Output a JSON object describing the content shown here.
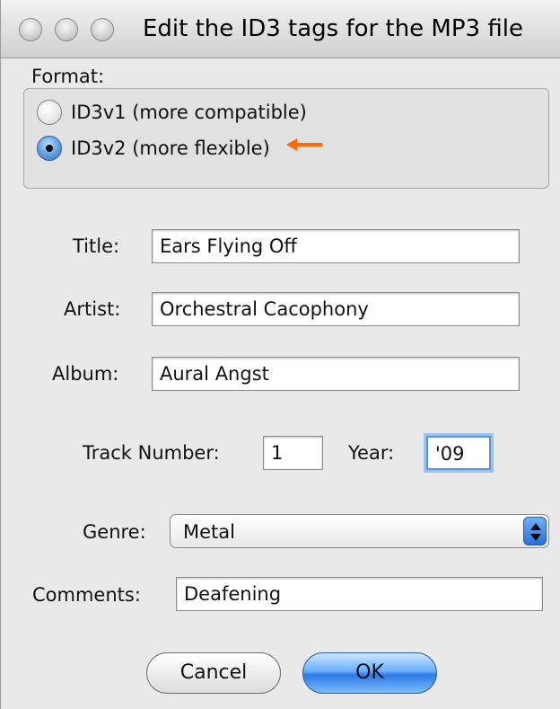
{
  "window": {
    "title": "Edit the ID3 tags for the MP3 file"
  },
  "format": {
    "label": "Format:",
    "options": [
      {
        "label": "ID3v1 (more compatible)",
        "selected": false
      },
      {
        "label": "ID3v2 (more flexible)",
        "selected": true
      }
    ],
    "annotation_color": "#ff6a00"
  },
  "fields": {
    "title": {
      "label": "Title:",
      "value": "Ears Flying Off"
    },
    "artist": {
      "label": "Artist:",
      "value": "Orchestral Cacophony"
    },
    "album": {
      "label": "Album:",
      "value": "Aural Angst"
    },
    "track_number": {
      "label": "Track Number:",
      "value": "1"
    },
    "year": {
      "label": "Year:",
      "value": "'09"
    },
    "genre": {
      "label": "Genre:",
      "value": "Metal"
    },
    "comments": {
      "label": "Comments:",
      "value": "Deafening"
    }
  },
  "buttons": {
    "cancel": "Cancel",
    "ok": "OK"
  },
  "icons": {
    "window_controls": [
      "close-icon",
      "minimize-icon",
      "zoom-icon"
    ],
    "genre_stepper": "up-down-arrows-icon",
    "annotation": "arrow-left-icon"
  },
  "colors": {
    "accent": "#2f6fd0",
    "focus": "#5a93d6"
  }
}
